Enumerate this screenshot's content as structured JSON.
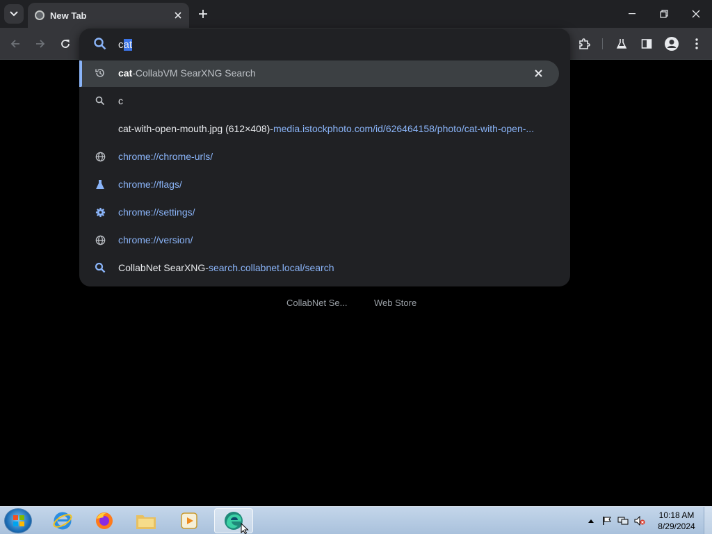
{
  "browser": {
    "tab": {
      "title": "New Tab"
    },
    "toolbar": {
      "back_icon": "arrow-left-icon",
      "forward_icon": "arrow-right-icon",
      "reload_icon": "reload-icon"
    },
    "omnibox": {
      "typed": "c",
      "autocomplete_selected": "at",
      "suggestions": [
        {
          "icon": "history-icon",
          "bold": "cat",
          "sep": " - ",
          "desc": "CollabVM SearXNG Search",
          "highlighted": true
        },
        {
          "icon": "search-icon",
          "text": "c"
        },
        {
          "icon": "none",
          "title": "cat-with-open-mouth.jpg (612×408)",
          "sep": " - ",
          "url": "media.istockphoto.com/id/626464158/photo/cat-with-open-..."
        },
        {
          "icon": "globe-icon",
          "url": "chrome://chrome-urls/"
        },
        {
          "icon": "flask-icon",
          "url": "chrome://flags/"
        },
        {
          "icon": "gear-icon",
          "url": "chrome://settings/"
        },
        {
          "icon": "globe-icon",
          "url": "chrome://version/"
        },
        {
          "icon": "search-icon",
          "title": "CollabNet SearXNG",
          "sep": " - ",
          "url": "search.collabnet.local/search"
        }
      ]
    },
    "shortcuts": [
      "CollabNet Se...",
      "Web Store"
    ]
  },
  "taskbar": {
    "apps": [
      "internet-explorer",
      "firefox",
      "file-explorer",
      "media-player",
      "edge"
    ],
    "clock_time": "10:18 AM",
    "clock_date": "8/29/2024"
  },
  "colors": {
    "accent": "#8ab4f8",
    "selection": "#3b74e8",
    "popup_bg": "#202124"
  }
}
